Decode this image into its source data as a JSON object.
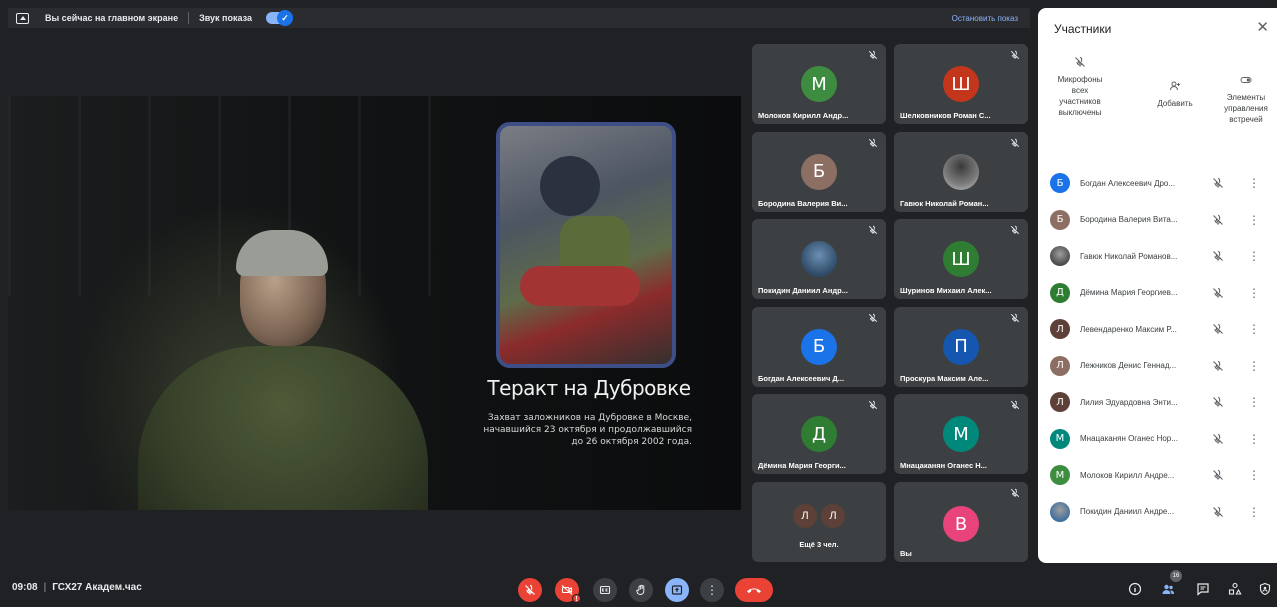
{
  "topbar": {
    "presenting_text": "Вы сейчас на главном экране",
    "sound_label": "Звук показа",
    "stop_label": "Остановить показ"
  },
  "presentation": {
    "title": "Теракт на Дубровке",
    "description": "Захват заложников на Дубровке в Москве,\nначавшийся 23 октября и продолжавшийся\nдо 26 октября 2002 года."
  },
  "tiles": [
    {
      "name": "Молоков Кирилл Андр...",
      "initial": "М",
      "color": "#3d8c40"
    },
    {
      "name": "Шелковников Роман С...",
      "initial": "Ш",
      "color": "#c4361b"
    },
    {
      "name": "Бородина Валерия Ви...",
      "initial": "Б",
      "color": "#8d6e63"
    },
    {
      "name": "Гавюк Николай Роман...",
      "initial": "",
      "color": "#4a4a4a"
    },
    {
      "name": "Покидин Даниил Андр...",
      "initial": "",
      "color": "#3f6f9e"
    },
    {
      "name": "Шуринов Михаил Алек...",
      "initial": "Ш",
      "color": "#2e7d32"
    },
    {
      "name": "Богдан Алексеевич Д...",
      "initial": "Б",
      "color": "#1a73e8"
    },
    {
      "name": "Проскура Максим Але...",
      "initial": "П",
      "color": "#1557b0"
    },
    {
      "name": "Дёмина Мария Георги...",
      "initial": "Д",
      "color": "#2e7d32"
    },
    {
      "name": "Мнацаканян Оганес Н...",
      "initial": "М",
      "color": "#00897b"
    }
  ],
  "more_tile": {
    "initials": [
      "Л",
      "Л"
    ],
    "label": "Ещё 3 чел."
  },
  "self_tile": {
    "name": "Вы",
    "initial": "В",
    "color": "#e8437a"
  },
  "panel": {
    "title": "Участники",
    "actions": {
      "mute_all": "Микрофоны\nвсех\nучастников\nвыключены",
      "add": "Добавить",
      "controls": "Элементы\nуправления\nвстречей"
    },
    "participants": [
      {
        "name": "Богдан Алексеевич Дро...",
        "initial": "Б",
        "color": "#1a73e8"
      },
      {
        "name": "Бородина Валерия Вита...",
        "initial": "Б",
        "color": "#8d6e63"
      },
      {
        "name": "Гавюк Николай Романов...",
        "initial": "",
        "color": "#4a4a4a"
      },
      {
        "name": "Дёмина Мария Георгиев...",
        "initial": "Д",
        "color": "#2e7d32"
      },
      {
        "name": "Левендаренко Максим Р...",
        "initial": "Л",
        "color": "#5d4037"
      },
      {
        "name": "Лежников Денис Геннад...",
        "initial": "Л",
        "color": "#8d6e63"
      },
      {
        "name": "Лилия Эдуардовна Энти...",
        "initial": "Л",
        "color": "#5d4037"
      },
      {
        "name": "Мнацаканян Оганес Нор...",
        "initial": "М",
        "color": "#00897b"
      },
      {
        "name": "Молоков Кирилл Андре...",
        "initial": "М",
        "color": "#3d8c40"
      },
      {
        "name": "Покидин Даниил Андре...",
        "initial": "",
        "color": "#3f6f9e"
      }
    ]
  },
  "bottom": {
    "time": "09:08",
    "meeting_name": "ГСХ27 Академ.час",
    "participant_count": "16",
    "camera_error_badge": "!"
  }
}
